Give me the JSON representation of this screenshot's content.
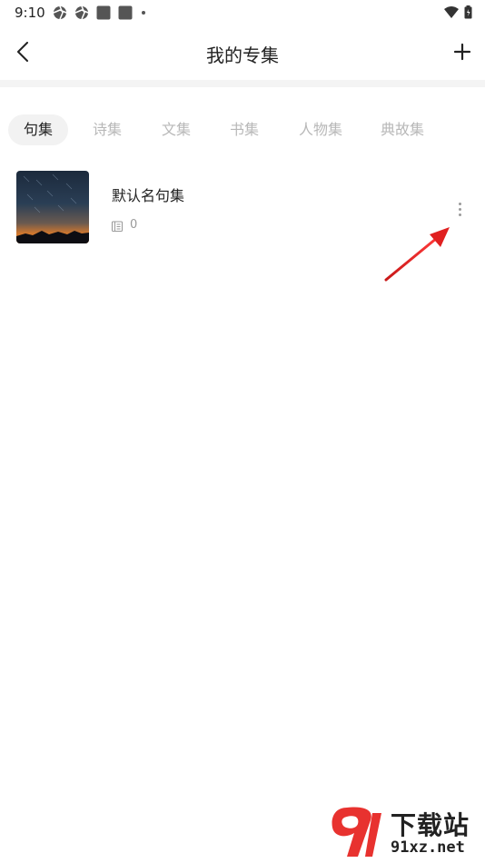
{
  "status_bar": {
    "time": "9:10"
  },
  "header": {
    "title": "我的专集"
  },
  "tabs": [
    {
      "label": "句集",
      "active": true
    },
    {
      "label": "诗集",
      "active": false
    },
    {
      "label": "文集",
      "active": false
    },
    {
      "label": "书集",
      "active": false
    },
    {
      "label": "人物集",
      "active": false
    },
    {
      "label": "典故集",
      "active": false
    }
  ],
  "collections": [
    {
      "title": "默认名句集",
      "count": "0"
    }
  ],
  "watermark": {
    "cn": "下载站",
    "en": "91xz.net"
  },
  "colors": {
    "annotation_arrow": "#e02020",
    "watermark_accent": "#e8322f",
    "tab_active_bg": "#f2f2f2",
    "tab_inactive_text": "#b8b8b8"
  }
}
